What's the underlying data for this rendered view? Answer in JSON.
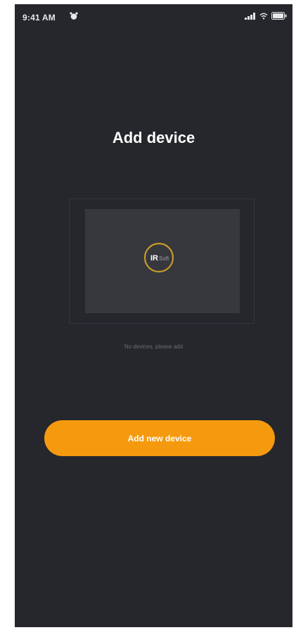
{
  "status_bar": {
    "time": "9:41 AM",
    "alarm_icon": "alarm-icon",
    "signal_icon": "cellular-signal-icon",
    "wifi_icon": "wifi-icon",
    "battery_icon": "battery-icon"
  },
  "page": {
    "title": "Add device"
  },
  "device_preview": {
    "logo_text_ir": "IR",
    "logo_text_rest": "Soft",
    "accent_color": "#c79a2a"
  },
  "empty_state": {
    "hint": "No devices, please add"
  },
  "actions": {
    "add_device_label": "Add new device"
  },
  "colors": {
    "background": "#25272c",
    "primary": "#f59a0e"
  }
}
